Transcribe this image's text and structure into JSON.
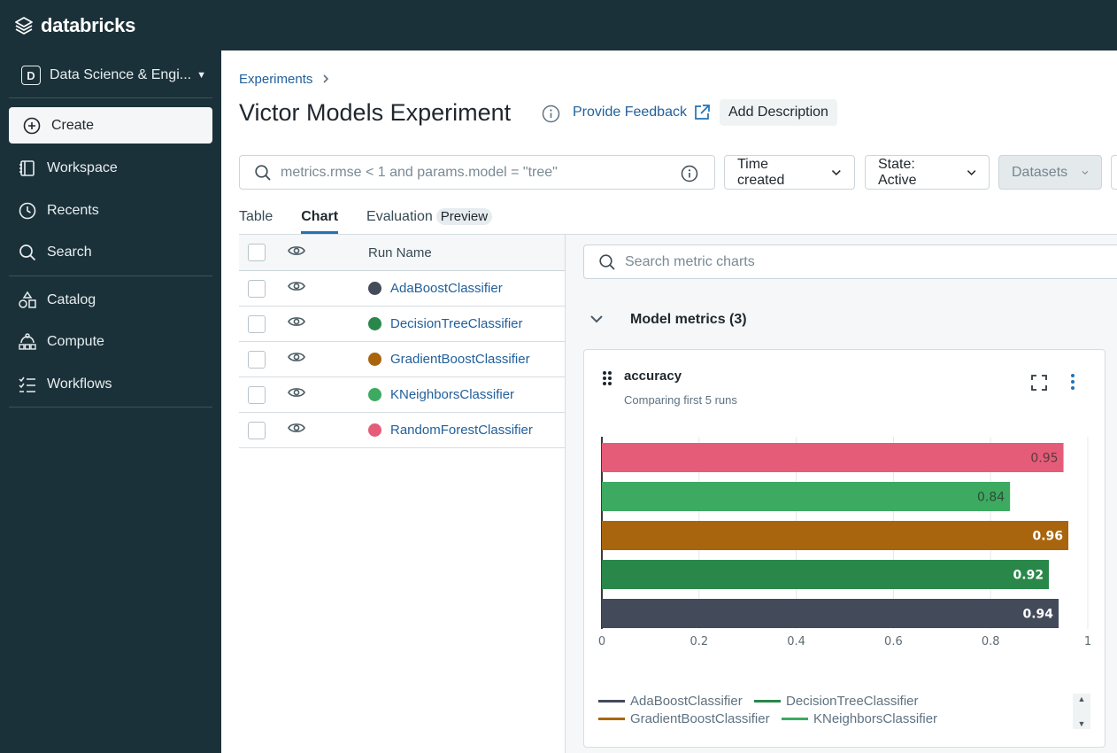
{
  "app": {
    "logo_text": "databricks"
  },
  "sidebar": {
    "workspace_badge": "D",
    "workspace_name": "Data Science & Engi...",
    "create_label": "Create",
    "items": [
      {
        "label": "Workspace",
        "icon": "workspace-icon"
      },
      {
        "label": "Recents",
        "icon": "clock-icon"
      },
      {
        "label": "Search",
        "icon": "search-icon"
      },
      {
        "label": "Catalog",
        "icon": "catalog-icon"
      },
      {
        "label": "Compute",
        "icon": "compute-icon"
      },
      {
        "label": "Workflows",
        "icon": "workflows-icon"
      }
    ]
  },
  "header": {
    "breadcrumb": "Experiments",
    "title": "Victor Models Experiment",
    "feedback_label": "Provide Feedback",
    "add_description_label": "Add Description"
  },
  "filters": {
    "search_placeholder": "metrics.rmse < 1 and params.model = \"tree\"",
    "sort_label": "Time created",
    "state_label": "State: Active",
    "datasets_label": "Datasets"
  },
  "tabs": {
    "table": "Table",
    "chart": "Chart",
    "evaluation": "Evaluation",
    "preview": "Preview"
  },
  "runs": {
    "header_label": "Run Name",
    "rows": [
      {
        "name": "AdaBoostClassifier",
        "color": "#434a5a"
      },
      {
        "name": "DecisionTreeClassifier",
        "color": "#29874a"
      },
      {
        "name": "GradientBoostClassifier",
        "color": "#a9650d"
      },
      {
        "name": "KNeighborsClassifier",
        "color": "#3caa60"
      },
      {
        "name": "RandomForestClassifier",
        "color": "#e55c78"
      }
    ]
  },
  "charts_panel": {
    "search_placeholder": "Search metric charts",
    "section_title": "Model metrics (3)",
    "card_title": "accuracy",
    "card_subtitle": "Comparing first 5 runs"
  },
  "chart_data": {
    "type": "bar",
    "orientation": "horizontal",
    "title": "accuracy",
    "categories": [
      "RandomForestClassifier",
      "KNeighborsClassifier",
      "GradientBoostClassifier",
      "DecisionTreeClassifier",
      "AdaBoostClassifier"
    ],
    "values": [
      0.95,
      0.84,
      0.96,
      0.92,
      0.94
    ],
    "value_labels": [
      "0.95",
      "0.84",
      "0.96",
      "0.92",
      "0.94"
    ],
    "colors": [
      "#e55c78",
      "#3caa60",
      "#a9650d",
      "#29874a",
      "#434a5a"
    ],
    "label_colors": [
      "#5a3a40",
      "#2f4a37",
      "#ffffff",
      "#ffffff",
      "#ffffff"
    ],
    "xlim": [
      0,
      1
    ],
    "xticks": [
      0,
      0.2,
      0.4,
      0.6,
      0.8,
      1
    ],
    "xtick_labels": [
      "0",
      "0.2",
      "0.4",
      "0.6",
      "0.8",
      "1"
    ],
    "grid": true,
    "legend": [
      {
        "name": "AdaBoostClassifier",
        "color": "#434a5a"
      },
      {
        "name": "DecisionTreeClassifier",
        "color": "#29874a"
      },
      {
        "name": "GradientBoostClassifier",
        "color": "#a9650d"
      },
      {
        "name": "KNeighborsClassifier",
        "color": "#3caa60"
      }
    ],
    "legend_position": "bottom"
  }
}
